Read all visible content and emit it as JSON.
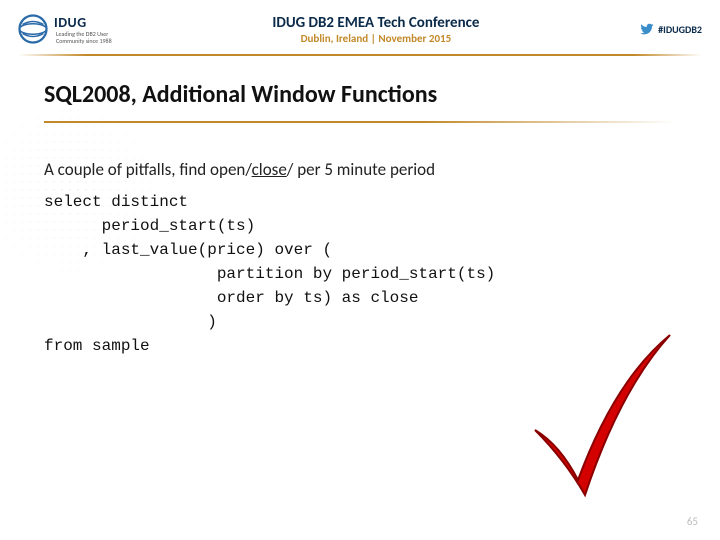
{
  "header": {
    "logo_text": "IDUG",
    "logo_sub1": "Leading the DB2 User",
    "logo_sub2": "Community since 1988",
    "title": "IDUG DB2 EMEA Tech Conference",
    "subtitle": "Dublin, Ireland  |  November 2015",
    "hashtag": "#IDUGDB2"
  },
  "slide": {
    "title": "SQL2008, Additional Window Functions",
    "intro_prefix": "A couple of pitfalls, find open/",
    "intro_underlined": "close",
    "intro_suffix": "/ per 5 minute period"
  },
  "code": {
    "l1": "select distinct",
    "l2": "      period_start(ts)",
    "l3": "    , last_value(price) over (",
    "l4": "                  partition by period_start(ts)",
    "l5": "                  order by ts) as close",
    "l6": "                 )",
    "l7": "from sample"
  },
  "page_number": "65"
}
